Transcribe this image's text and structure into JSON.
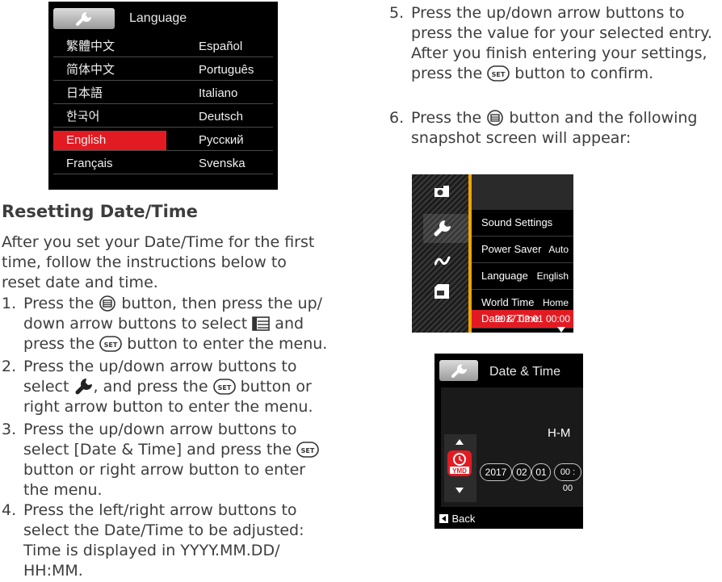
{
  "language_screen": {
    "title": "Language",
    "icon": "wrench-icon",
    "rows": [
      {
        "left": "繁體中文",
        "right": "Español"
      },
      {
        "left": "简体中文",
        "right": "Português"
      },
      {
        "left": "日本語",
        "right": "Italiano"
      },
      {
        "left": "한국어",
        "right": "Deutsch"
      },
      {
        "left": "English",
        "right": "Русский"
      },
      {
        "left": "Français",
        "right": "Svenska"
      }
    ],
    "selected_row": 4,
    "accent_color": "#e21b23"
  },
  "section": {
    "heading": "Resetting Date/Time",
    "intro": [
      "After you set your Date/Time for the first",
      "time, follow the instructions below to",
      "reset date and time."
    ]
  },
  "steps": {
    "s1": {
      "num": "1.",
      "a": "Press the",
      "b": "button, then press the up/",
      "c": "down arrow buttons to select",
      "d": "and",
      "e": "press the",
      "f": "button to enter the menu."
    },
    "s2": {
      "num": "2.",
      "a": "Press the up/down arrow buttons to",
      "b": "select",
      "c": ", and press the",
      "d": "button or",
      "e": "right arrow button to enter the menu."
    },
    "s3": {
      "num": "3.",
      "a": "Press the up/down arrow buttons to",
      "b": "select [Date & Time] and press the",
      "c": "button or right arrow button to enter",
      "d": "the menu."
    },
    "s4": {
      "num": "4.",
      "a": "Press the left/right arrow buttons to",
      "b": "select the Date/Time to be adjusted:",
      "c": "Time is displayed in YYYY.MM.DD/",
      "d": "HH:MM."
    },
    "s5": {
      "num": "5.",
      "a": "Press the up/down arrow buttons to",
      "b": "press the value for your selected entry.",
      "c": "After you finish entering your settings,",
      "d": "press the",
      "e": "button to confirm."
    },
    "s6": {
      "num": "6.",
      "a": "Press the",
      "b": "button and the following",
      "c": "snapshot screen will appear:"
    }
  },
  "set_label": "SET",
  "menu_screen": {
    "accent_color": "#f0a300",
    "rows": [
      {
        "label": "Sound Settings",
        "value": ""
      },
      {
        "label": "Power Saver",
        "value": "Auto"
      },
      {
        "label": "Language",
        "value": "English"
      },
      {
        "label": "World Time",
        "value": "Home"
      },
      {
        "label": "Date & Time",
        "value": "2017.02.01 00:00"
      }
    ],
    "selected_row": 4,
    "side_icons": [
      "camera-icon",
      "wrench-icon",
      "wave-icon",
      "sd-card-icon"
    ]
  },
  "datetime_screen": {
    "title": "Date & Time",
    "format": "H-M",
    "format_icon_label": "YMD",
    "year": "2017",
    "month": "02",
    "day": "01",
    "time": "00 : 00",
    "back_label": "Back"
  }
}
